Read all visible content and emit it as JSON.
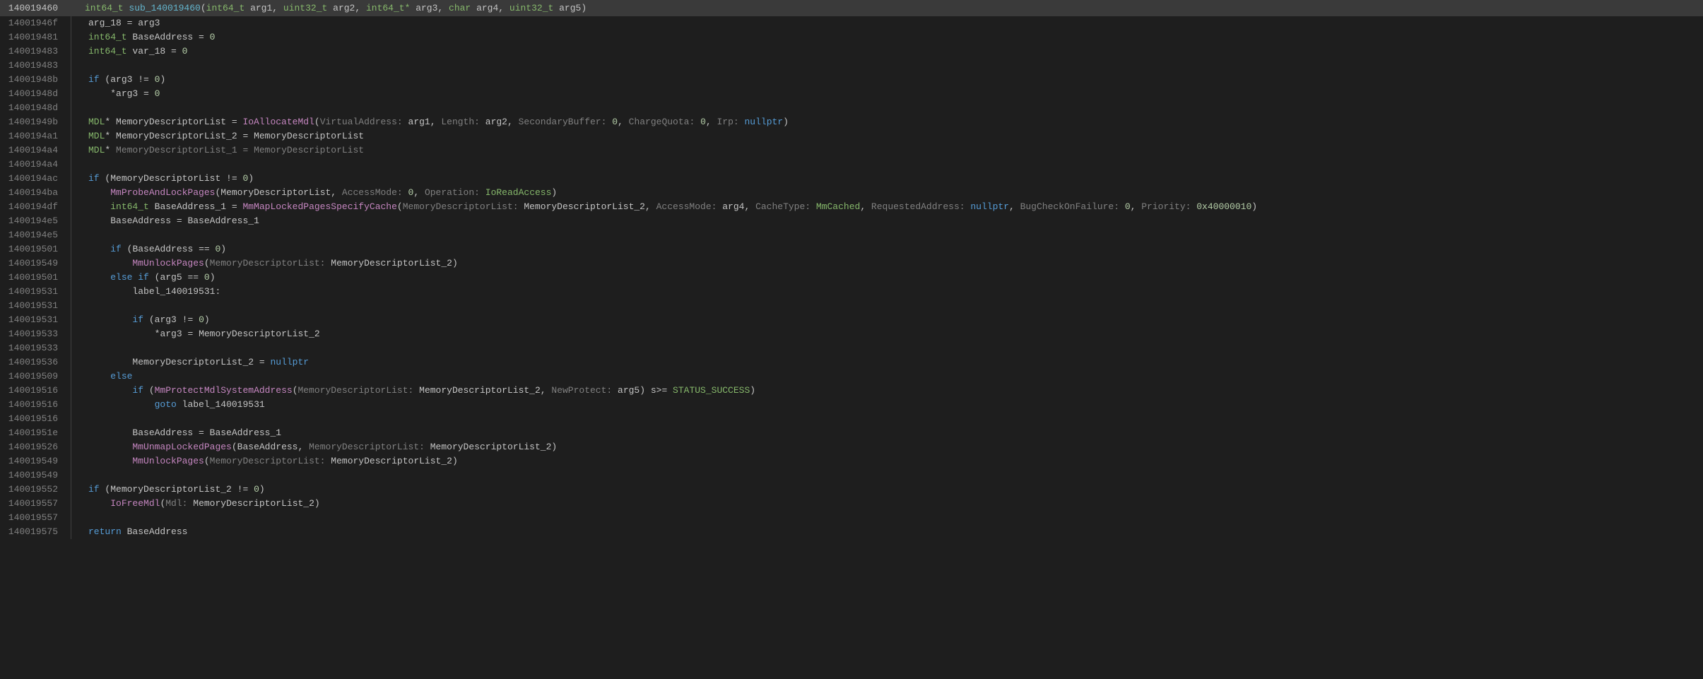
{
  "header": {
    "addr": "140019460",
    "return_type": "int64_t",
    "fn_name": "sub_140019460",
    "params": [
      {
        "type": "int64_t",
        "name": "arg1"
      },
      {
        "type": "uint32_t",
        "name": "arg2"
      },
      {
        "type": "int64_t*",
        "name": "arg3"
      },
      {
        "type": "char",
        "name": "arg4"
      },
      {
        "type": "uint32_t",
        "name": "arg5"
      }
    ]
  },
  "lines": [
    {
      "addr": "14001946f",
      "indent": 0,
      "tokens": [
        {
          "t": "var",
          "v": "arg_18"
        },
        {
          "t": "op",
          "v": " = "
        },
        {
          "t": "var",
          "v": "arg3"
        }
      ]
    },
    {
      "addr": "140019481",
      "indent": 0,
      "tokens": [
        {
          "t": "type",
          "v": "int64_t"
        },
        {
          "t": "op",
          "v": " "
        },
        {
          "t": "var",
          "v": "BaseAddress"
        },
        {
          "t": "op",
          "v": " = "
        },
        {
          "t": "num",
          "v": "0"
        }
      ]
    },
    {
      "addr": "140019483",
      "indent": 0,
      "tokens": [
        {
          "t": "type",
          "v": "int64_t"
        },
        {
          "t": "op",
          "v": " "
        },
        {
          "t": "var",
          "v": "var_18"
        },
        {
          "t": "op",
          "v": " = "
        },
        {
          "t": "num",
          "v": "0"
        }
      ]
    },
    {
      "addr": "140019483",
      "indent": 0,
      "tokens": []
    },
    {
      "addr": "14001948b",
      "indent": 0,
      "tokens": [
        {
          "t": "keyword",
          "v": "if"
        },
        {
          "t": "op",
          "v": " ("
        },
        {
          "t": "var",
          "v": "arg3"
        },
        {
          "t": "op",
          "v": " != "
        },
        {
          "t": "num",
          "v": "0"
        },
        {
          "t": "op",
          "v": ")"
        }
      ]
    },
    {
      "addr": "14001948d",
      "indent": 1,
      "tokens": [
        {
          "t": "op",
          "v": "*"
        },
        {
          "t": "var",
          "v": "arg3"
        },
        {
          "t": "op",
          "v": " = "
        },
        {
          "t": "num",
          "v": "0"
        }
      ]
    },
    {
      "addr": "14001948d",
      "indent": 0,
      "tokens": []
    },
    {
      "addr": "14001949b",
      "indent": 0,
      "tokens": [
        {
          "t": "type",
          "v": "MDL"
        },
        {
          "t": "op",
          "v": "* "
        },
        {
          "t": "var",
          "v": "MemoryDescriptorList"
        },
        {
          "t": "op",
          "v": " = "
        },
        {
          "t": "call",
          "v": "IoAllocateMdl"
        },
        {
          "t": "op",
          "v": "("
        },
        {
          "t": "named-arg",
          "v": "VirtualAddress: "
        },
        {
          "t": "var",
          "v": "arg1"
        },
        {
          "t": "op",
          "v": ", "
        },
        {
          "t": "named-arg",
          "v": "Length: "
        },
        {
          "t": "var",
          "v": "arg2"
        },
        {
          "t": "op",
          "v": ", "
        },
        {
          "t": "named-arg",
          "v": "SecondaryBuffer: "
        },
        {
          "t": "num",
          "v": "0"
        },
        {
          "t": "op",
          "v": ", "
        },
        {
          "t": "named-arg",
          "v": "ChargeQuota: "
        },
        {
          "t": "num",
          "v": "0"
        },
        {
          "t": "op",
          "v": ", "
        },
        {
          "t": "named-arg",
          "v": "Irp: "
        },
        {
          "t": "nullptr",
          "v": "nullptr"
        },
        {
          "t": "op",
          "v": ")"
        }
      ]
    },
    {
      "addr": "1400194a1",
      "indent": 0,
      "tokens": [
        {
          "t": "type",
          "v": "MDL"
        },
        {
          "t": "op",
          "v": "* "
        },
        {
          "t": "var",
          "v": "MemoryDescriptorList_2"
        },
        {
          "t": "op",
          "v": " = "
        },
        {
          "t": "var",
          "v": "MemoryDescriptorList"
        }
      ]
    },
    {
      "addr": "1400194a4",
      "indent": 0,
      "tokens": [
        {
          "t": "type",
          "v": "MDL"
        },
        {
          "t": "op",
          "v": "* "
        },
        {
          "t": "comment-var",
          "v": "MemoryDescriptorList_1"
        },
        {
          "t": "comment-var",
          "v": " = "
        },
        {
          "t": "comment-var",
          "v": "MemoryDescriptorList"
        }
      ]
    },
    {
      "addr": "1400194a4",
      "indent": 0,
      "tokens": []
    },
    {
      "addr": "1400194ac",
      "indent": 0,
      "tokens": [
        {
          "t": "keyword",
          "v": "if"
        },
        {
          "t": "op",
          "v": " ("
        },
        {
          "t": "var",
          "v": "MemoryDescriptorList"
        },
        {
          "t": "op",
          "v": " != "
        },
        {
          "t": "num",
          "v": "0"
        },
        {
          "t": "op",
          "v": ")"
        }
      ]
    },
    {
      "addr": "1400194ba",
      "indent": 1,
      "tokens": [
        {
          "t": "call",
          "v": "MmProbeAndLockPages"
        },
        {
          "t": "op",
          "v": "("
        },
        {
          "t": "var",
          "v": "MemoryDescriptorList"
        },
        {
          "t": "op",
          "v": ", "
        },
        {
          "t": "named-arg",
          "v": "AccessMode: "
        },
        {
          "t": "num",
          "v": "0"
        },
        {
          "t": "op",
          "v": ", "
        },
        {
          "t": "named-arg",
          "v": "Operation: "
        },
        {
          "t": "enum",
          "v": "IoReadAccess"
        },
        {
          "t": "op",
          "v": ")"
        }
      ]
    },
    {
      "addr": "1400194df",
      "indent": 1,
      "tokens": [
        {
          "t": "type",
          "v": "int64_t"
        },
        {
          "t": "op",
          "v": " "
        },
        {
          "t": "var",
          "v": "BaseAddress_1"
        },
        {
          "t": "op",
          "v": " = "
        },
        {
          "t": "call",
          "v": "MmMapLockedPagesSpecifyCache"
        },
        {
          "t": "op",
          "v": "("
        },
        {
          "t": "named-arg",
          "v": "MemoryDescriptorList: "
        },
        {
          "t": "var",
          "v": "MemoryDescriptorList_2"
        },
        {
          "t": "op",
          "v": ", "
        },
        {
          "t": "named-arg",
          "v": "AccessMode: "
        },
        {
          "t": "var",
          "v": "arg4"
        },
        {
          "t": "op",
          "v": ", "
        },
        {
          "t": "named-arg",
          "v": "CacheType: "
        },
        {
          "t": "enum",
          "v": "MmCached"
        },
        {
          "t": "op",
          "v": ", "
        },
        {
          "t": "named-arg",
          "v": "RequestedAddress: "
        },
        {
          "t": "nullptr",
          "v": "nullptr"
        },
        {
          "t": "op",
          "v": ", "
        },
        {
          "t": "named-arg",
          "v": "BugCheckOnFailure: "
        },
        {
          "t": "num",
          "v": "0"
        },
        {
          "t": "op",
          "v": ", "
        },
        {
          "t": "named-arg",
          "v": "Priority: "
        },
        {
          "t": "num",
          "v": "0x40000010"
        },
        {
          "t": "op",
          "v": ")"
        }
      ]
    },
    {
      "addr": "1400194e5",
      "indent": 1,
      "tokens": [
        {
          "t": "var",
          "v": "BaseAddress"
        },
        {
          "t": "op",
          "v": " = "
        },
        {
          "t": "var",
          "v": "BaseAddress_1"
        }
      ]
    },
    {
      "addr": "1400194e5",
      "indent": 1,
      "tokens": []
    },
    {
      "addr": "140019501",
      "indent": 1,
      "tokens": [
        {
          "t": "keyword",
          "v": "if"
        },
        {
          "t": "op",
          "v": " ("
        },
        {
          "t": "var",
          "v": "BaseAddress"
        },
        {
          "t": "op",
          "v": " == "
        },
        {
          "t": "num",
          "v": "0"
        },
        {
          "t": "op",
          "v": ")"
        }
      ]
    },
    {
      "addr": "140019549",
      "indent": 2,
      "tokens": [
        {
          "t": "call",
          "v": "MmUnlockPages"
        },
        {
          "t": "op",
          "v": "("
        },
        {
          "t": "named-arg",
          "v": "MemoryDescriptorList: "
        },
        {
          "t": "var",
          "v": "MemoryDescriptorList_2"
        },
        {
          "t": "op",
          "v": ")"
        }
      ]
    },
    {
      "addr": "140019501",
      "indent": 1,
      "tokens": [
        {
          "t": "keyword",
          "v": "else if"
        },
        {
          "t": "op",
          "v": " ("
        },
        {
          "t": "var",
          "v": "arg5"
        },
        {
          "t": "op",
          "v": " == "
        },
        {
          "t": "num",
          "v": "0"
        },
        {
          "t": "op",
          "v": ")"
        }
      ]
    },
    {
      "addr": "140019531",
      "indent": 2,
      "tokens": [
        {
          "t": "var",
          "v": "label_140019531:"
        }
      ]
    },
    {
      "addr": "140019531",
      "indent": 2,
      "tokens": []
    },
    {
      "addr": "140019531",
      "indent": 2,
      "tokens": [
        {
          "t": "keyword",
          "v": "if"
        },
        {
          "t": "op",
          "v": " ("
        },
        {
          "t": "var",
          "v": "arg3"
        },
        {
          "t": "op",
          "v": " != "
        },
        {
          "t": "num",
          "v": "0"
        },
        {
          "t": "op",
          "v": ")"
        }
      ]
    },
    {
      "addr": "140019533",
      "indent": 3,
      "tokens": [
        {
          "t": "op",
          "v": "*"
        },
        {
          "t": "var",
          "v": "arg3"
        },
        {
          "t": "op",
          "v": " = "
        },
        {
          "t": "var",
          "v": "MemoryDescriptorList_2"
        }
      ]
    },
    {
      "addr": "140019533",
      "indent": 2,
      "tokens": []
    },
    {
      "addr": "140019536",
      "indent": 2,
      "tokens": [
        {
          "t": "var",
          "v": "MemoryDescriptorList_2"
        },
        {
          "t": "op",
          "v": " = "
        },
        {
          "t": "nullptr",
          "v": "nullptr"
        }
      ]
    },
    {
      "addr": "140019509",
      "indent": 1,
      "tokens": [
        {
          "t": "keyword",
          "v": "else"
        }
      ]
    },
    {
      "addr": "140019516",
      "indent": 2,
      "tokens": [
        {
          "t": "keyword",
          "v": "if"
        },
        {
          "t": "op",
          "v": " ("
        },
        {
          "t": "call",
          "v": "MmProtectMdlSystemAddress"
        },
        {
          "t": "op",
          "v": "("
        },
        {
          "t": "named-arg",
          "v": "MemoryDescriptorList: "
        },
        {
          "t": "var",
          "v": "MemoryDescriptorList_2"
        },
        {
          "t": "op",
          "v": ", "
        },
        {
          "t": "named-arg",
          "v": "NewProtect: "
        },
        {
          "t": "var",
          "v": "arg5"
        },
        {
          "t": "op",
          "v": ") s>= "
        },
        {
          "t": "enum",
          "v": "STATUS_SUCCESS"
        },
        {
          "t": "op",
          "v": ")"
        }
      ]
    },
    {
      "addr": "140019516",
      "indent": 3,
      "tokens": [
        {
          "t": "keyword",
          "v": "goto"
        },
        {
          "t": "op",
          "v": " "
        },
        {
          "t": "var",
          "v": "label_140019531"
        }
      ]
    },
    {
      "addr": "140019516",
      "indent": 2,
      "tokens": []
    },
    {
      "addr": "14001951e",
      "indent": 2,
      "tokens": [
        {
          "t": "var",
          "v": "BaseAddress"
        },
        {
          "t": "op",
          "v": " = "
        },
        {
          "t": "var",
          "v": "BaseAddress_1"
        }
      ]
    },
    {
      "addr": "140019526",
      "indent": 2,
      "tokens": [
        {
          "t": "call",
          "v": "MmUnmapLockedPages"
        },
        {
          "t": "op",
          "v": "("
        },
        {
          "t": "var",
          "v": "BaseAddress"
        },
        {
          "t": "op",
          "v": ", "
        },
        {
          "t": "named-arg",
          "v": "MemoryDescriptorList: "
        },
        {
          "t": "var",
          "v": "MemoryDescriptorList_2"
        },
        {
          "t": "op",
          "v": ")"
        }
      ]
    },
    {
      "addr": "140019549",
      "indent": 2,
      "tokens": [
        {
          "t": "call",
          "v": "MmUnlockPages"
        },
        {
          "t": "op",
          "v": "("
        },
        {
          "t": "named-arg",
          "v": "MemoryDescriptorList: "
        },
        {
          "t": "var",
          "v": "MemoryDescriptorList_2"
        },
        {
          "t": "op",
          "v": ")"
        }
      ]
    },
    {
      "addr": "140019549",
      "indent": 0,
      "tokens": []
    },
    {
      "addr": "140019552",
      "indent": 0,
      "tokens": [
        {
          "t": "keyword",
          "v": "if"
        },
        {
          "t": "op",
          "v": " ("
        },
        {
          "t": "var",
          "v": "MemoryDescriptorList_2"
        },
        {
          "t": "op",
          "v": " != "
        },
        {
          "t": "num",
          "v": "0"
        },
        {
          "t": "op",
          "v": ")"
        }
      ]
    },
    {
      "addr": "140019557",
      "indent": 1,
      "tokens": [
        {
          "t": "call",
          "v": "IoFreeMdl"
        },
        {
          "t": "op",
          "v": "("
        },
        {
          "t": "named-arg",
          "v": "Mdl: "
        },
        {
          "t": "var",
          "v": "MemoryDescriptorList_2"
        },
        {
          "t": "op",
          "v": ")"
        }
      ]
    },
    {
      "addr": "140019557",
      "indent": 0,
      "tokens": []
    },
    {
      "addr": "140019575",
      "indent": 0,
      "tokens": [
        {
          "t": "keyword",
          "v": "return"
        },
        {
          "t": "op",
          "v": " "
        },
        {
          "t": "var",
          "v": "BaseAddress"
        }
      ]
    }
  ]
}
